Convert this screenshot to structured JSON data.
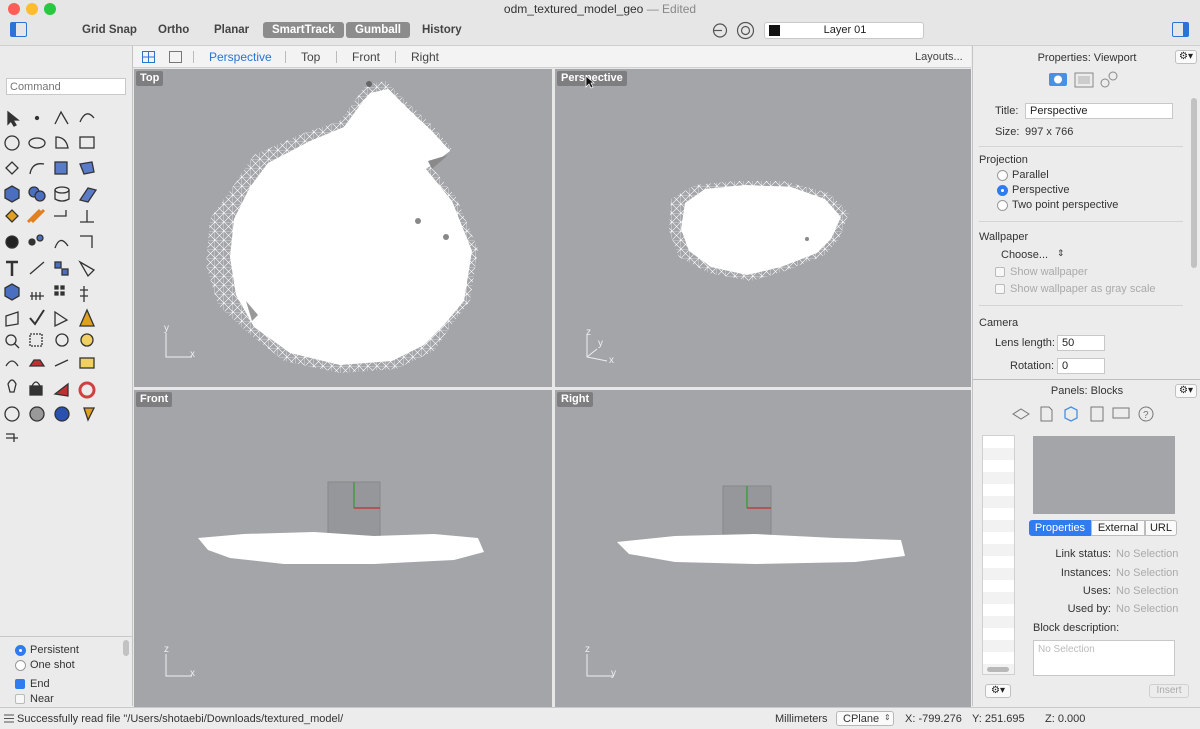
{
  "window": {
    "title": "odm_textured_model_geo",
    "title_suffix": "— Edited"
  },
  "toolbar": {
    "grid_snap": "Grid Snap",
    "ortho": "Ortho",
    "planar": "Planar",
    "smarttrack": "SmartTrack",
    "gumball": "Gumball",
    "history": "History",
    "layer_name": "Layer 01"
  },
  "command": {
    "placeholder": "Command"
  },
  "viewport_tabs": {
    "perspective": "Perspective",
    "top": "Top",
    "front": "Front",
    "right": "Right",
    "layouts": "Layouts..."
  },
  "viewports": {
    "top": "Top",
    "perspective": "Perspective",
    "front": "Front",
    "right": "Right"
  },
  "axes": {
    "x": "x",
    "y": "y",
    "z": "z"
  },
  "osnap": {
    "persistent": "Persistent",
    "one_shot": "One shot",
    "end": "End",
    "near": "Near"
  },
  "properties": {
    "header": "Properties: Viewport",
    "title_label": "Title:",
    "title_value": "Perspective",
    "size_label": "Size:",
    "size_value": "997 x 766",
    "projection_heading": "Projection",
    "parallel": "Parallel",
    "perspective": "Perspective",
    "two_point": "Two point perspective",
    "wallpaper_heading": "Wallpaper",
    "choose": "Choose...",
    "show_wallpaper": "Show wallpaper",
    "show_gray": "Show wallpaper as gray scale",
    "camera_heading": "Camera",
    "lens_label": "Lens length:",
    "lens_value": "50",
    "rotation_label": "Rotation:",
    "rotation_value": "0"
  },
  "blocks": {
    "header": "Panels: Blocks",
    "tab_properties": "Properties",
    "tab_external": "External",
    "tab_url": "URL",
    "link_status_label": "Link status:",
    "instances_label": "Instances:",
    "uses_label": "Uses:",
    "used_by_label": "Used by:",
    "no_selection": "No Selection",
    "description_label": "Block description:",
    "insert": "Insert"
  },
  "status": {
    "message": "Successfully read file \"/Users/shotaebi/Downloads/textured_model/",
    "units": "Millimeters",
    "cplane": "CPlane",
    "x": "X: -799.276",
    "y": "Y: 251.695",
    "z": "Z: 0.000"
  },
  "colors": {
    "accent": "#2f7bf0",
    "viewport_bg": "#a3a5a9",
    "mesh": "#ffffff"
  }
}
